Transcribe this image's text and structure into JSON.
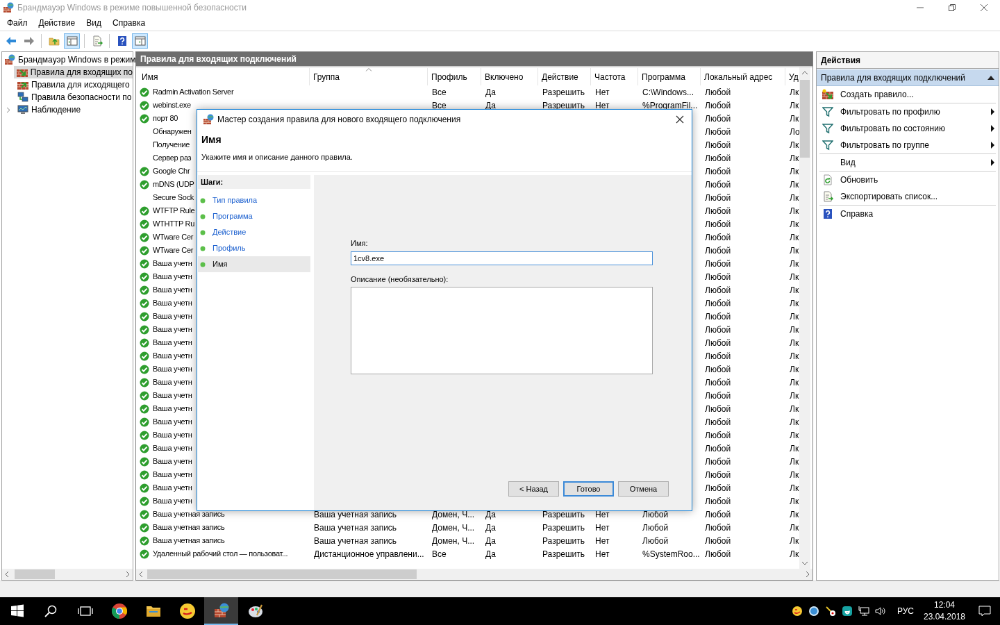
{
  "window": {
    "title": "Брандмауэр Windows в режиме повышенной безопасности"
  },
  "menu": [
    "Файл",
    "Действие",
    "Вид",
    "Справка"
  ],
  "toolbar": [
    {
      "kind": "back",
      "pressed": false
    },
    {
      "kind": "forward",
      "pressed": false
    },
    {
      "kind": "separator"
    },
    {
      "kind": "folder-up",
      "pressed": false
    },
    {
      "kind": "tree-pane",
      "pressed": true
    },
    {
      "kind": "separator"
    },
    {
      "kind": "export",
      "pressed": false
    },
    {
      "kind": "separator"
    },
    {
      "kind": "help",
      "pressed": false
    },
    {
      "kind": "action-pane",
      "pressed": true
    }
  ],
  "tree": {
    "label": "Брандмауэр Windows в режим",
    "kind": "root",
    "selected": false,
    "expandable": false,
    "children": [
      {
        "label": "Правила для входящих по",
        "kind": "inbound",
        "selected": true,
        "expandable": false
      },
      {
        "label": "Правила для исходящего",
        "kind": "outbound",
        "selected": false,
        "expandable": false
      },
      {
        "label": "Правила безопасности по",
        "kind": "security",
        "selected": false,
        "expandable": false
      },
      {
        "label": "Наблюдение",
        "kind": "monitoring",
        "selected": false,
        "expandable": true
      }
    ]
  },
  "panel": {
    "title": "Правила для входящих подключений",
    "columns": [
      {
        "label": "Имя",
        "sorted": false
      },
      {
        "label": "Группа",
        "sorted": true
      },
      {
        "label": "Профиль",
        "sorted": false
      },
      {
        "label": "Включено",
        "sorted": false
      },
      {
        "label": "Действие",
        "sorted": false
      },
      {
        "label": "Частота",
        "sorted": false
      },
      {
        "label": "Программа",
        "sorted": false
      },
      {
        "label": "Локальный адрес",
        "sorted": false
      },
      {
        "label": "Уд",
        "sorted": false
      }
    ],
    "rows": [
      {
        "enabled": true,
        "cells": [
          "Radmin Activation Server",
          null,
          "Все",
          "Да",
          "Разрешить",
          "Нет",
          "C:\\Windows...",
          "Любой",
          "Лк"
        ]
      },
      {
        "enabled": true,
        "cells": [
          "webinst.exe",
          null,
          "Все",
          "Да",
          "Разрешить",
          "Нет",
          "%ProgramFil...",
          "Любой",
          "Лк"
        ]
      },
      {
        "enabled": true,
        "cells": [
          "порт 80",
          null,
          null,
          null,
          null,
          null,
          null,
          "Любой",
          "Лк"
        ]
      },
      {
        "enabled": false,
        "cells": [
          "Обнаружен",
          null,
          null,
          null,
          null,
          null,
          null,
          "Любой",
          "Ло"
        ]
      },
      {
        "enabled": false,
        "cells": [
          "Получение",
          null,
          null,
          null,
          null,
          null,
          null,
          "Любой",
          "Лк"
        ]
      },
      {
        "enabled": false,
        "cells": [
          "Сервер раз",
          null,
          null,
          null,
          null,
          null,
          null,
          "Любой",
          "Лк"
        ]
      },
      {
        "enabled": true,
        "cells": [
          "Google Chr",
          null,
          null,
          null,
          null,
          null,
          null,
          "Любой",
          "Лк"
        ]
      },
      {
        "enabled": true,
        "cells": [
          "mDNS (UDP",
          null,
          null,
          null,
          null,
          null,
          null,
          "Любой",
          "Лк"
        ]
      },
      {
        "enabled": false,
        "cells": [
          "Secure Sock",
          null,
          null,
          null,
          null,
          null,
          null,
          "Любой",
          "Лк"
        ]
      },
      {
        "enabled": true,
        "cells": [
          "WTFTP Rule",
          null,
          null,
          null,
          null,
          null,
          null,
          "Любой",
          "Лк"
        ]
      },
      {
        "enabled": true,
        "cells": [
          "WTHTTP Ru",
          null,
          null,
          null,
          null,
          null,
          null,
          "Любой",
          "Лк"
        ]
      },
      {
        "enabled": true,
        "cells": [
          "WTware Cer",
          null,
          null,
          null,
          null,
          null,
          null,
          "Любой",
          "Лк"
        ]
      },
      {
        "enabled": true,
        "cells": [
          "WTware Cer",
          null,
          null,
          null,
          null,
          null,
          null,
          "Любой",
          "Лк"
        ]
      },
      {
        "enabled": true,
        "cells": [
          "Ваша учетн",
          null,
          null,
          null,
          null,
          null,
          null,
          "Любой",
          "Лк"
        ]
      },
      {
        "enabled": true,
        "cells": [
          "Ваша учетн",
          null,
          null,
          null,
          null,
          null,
          null,
          "Любой",
          "Лк"
        ]
      },
      {
        "enabled": true,
        "cells": [
          "Ваша учетн",
          null,
          null,
          null,
          null,
          null,
          null,
          "Любой",
          "Лк"
        ]
      },
      {
        "enabled": true,
        "cells": [
          "Ваша учетн",
          null,
          null,
          null,
          null,
          null,
          null,
          "Любой",
          "Лк"
        ]
      },
      {
        "enabled": true,
        "cells": [
          "Ваша учетн",
          null,
          null,
          null,
          null,
          null,
          null,
          "Любой",
          "Лк"
        ]
      },
      {
        "enabled": true,
        "cells": [
          "Ваша учетн",
          null,
          null,
          null,
          null,
          null,
          null,
          "Любой",
          "Лк"
        ]
      },
      {
        "enabled": true,
        "cells": [
          "Ваша учетн",
          null,
          null,
          null,
          null,
          null,
          null,
          "Любой",
          "Лк"
        ]
      },
      {
        "enabled": true,
        "cells": [
          "Ваша учетн",
          null,
          null,
          null,
          null,
          null,
          null,
          "Любой",
          "Лк"
        ]
      },
      {
        "enabled": true,
        "cells": [
          "Ваша учетн",
          null,
          null,
          null,
          null,
          null,
          null,
          "Любой",
          "Лк"
        ]
      },
      {
        "enabled": true,
        "cells": [
          "Ваша учетн",
          null,
          null,
          null,
          null,
          null,
          null,
          "Любой",
          "Лк"
        ]
      },
      {
        "enabled": true,
        "cells": [
          "Ваша учетн",
          null,
          null,
          null,
          null,
          null,
          null,
          "Любой",
          "Лк"
        ]
      },
      {
        "enabled": true,
        "cells": [
          "Ваша учетн",
          null,
          null,
          null,
          null,
          null,
          null,
          "Любой",
          "Лк"
        ]
      },
      {
        "enabled": true,
        "cells": [
          "Ваша учетн",
          null,
          null,
          null,
          null,
          null,
          null,
          "Любой",
          "Лк"
        ]
      },
      {
        "enabled": true,
        "cells": [
          "Ваша учетн",
          null,
          null,
          null,
          null,
          null,
          null,
          "Любой",
          "Лк"
        ]
      },
      {
        "enabled": true,
        "cells": [
          "Ваша учетн",
          null,
          null,
          null,
          null,
          null,
          null,
          "Любой",
          "Лк"
        ]
      },
      {
        "enabled": true,
        "cells": [
          "Ваша учетн",
          null,
          null,
          null,
          null,
          null,
          null,
          "Любой",
          "Лк"
        ]
      },
      {
        "enabled": true,
        "cells": [
          "Ваша учетн",
          null,
          null,
          null,
          null,
          null,
          null,
          "Любой",
          "Лк"
        ]
      },
      {
        "enabled": true,
        "cells": [
          "Ваша учетн",
          null,
          null,
          null,
          null,
          null,
          null,
          "Любой",
          "Лк"
        ]
      },
      {
        "enabled": true,
        "cells": [
          "Ваша учетн",
          null,
          null,
          null,
          null,
          null,
          null,
          "Любой",
          "Лк"
        ]
      },
      {
        "enabled": true,
        "cells": [
          "Ваша учетная запись",
          "Ваша учетная запись",
          "Домен, Ч...",
          "Да",
          "Разрешить",
          "Нет",
          "Любой",
          "Любой",
          "Лк"
        ]
      },
      {
        "enabled": true,
        "cells": [
          "Ваша учетная запись",
          "Ваша учетная запись",
          "Домен, Ч...",
          "Да",
          "Разрешить",
          "Нет",
          "Любой",
          "Любой",
          "Лк"
        ]
      },
      {
        "enabled": true,
        "cells": [
          "Ваша учетная запись",
          "Ваша учетная запись",
          "Домен, Ч...",
          "Да",
          "Разрешить",
          "Нет",
          "Любой",
          "Любой",
          "Лк"
        ]
      },
      {
        "enabled": true,
        "cells": [
          "Удаленный рабочий стол — пользоват...",
          "Дистанционное управлени...",
          "Все",
          "Да",
          "Разрешить",
          "Нет",
          "%SystemRoo...",
          "Любой",
          "Лк"
        ]
      }
    ]
  },
  "actions": {
    "title": "Действия",
    "section": {
      "label": "Правила для входящих подключений",
      "expanded": true
    },
    "items": [
      {
        "kind": "create",
        "label": "Создать правило...",
        "submenu": false,
        "separator_after": true
      },
      {
        "kind": "filter",
        "label": "Фильтровать по профилю",
        "submenu": true,
        "separator_after": false
      },
      {
        "kind": "filter",
        "label": "Фильтровать по состоянию",
        "submenu": true,
        "separator_after": false
      },
      {
        "kind": "filter",
        "label": "Фильтровать по группе",
        "submenu": true,
        "separator_after": true
      },
      {
        "kind": "none",
        "label": "Вид",
        "submenu": true,
        "separator_after": true
      },
      {
        "kind": "refresh",
        "label": "Обновить",
        "submenu": false,
        "separator_after": false
      },
      {
        "kind": "export",
        "label": "Экспортировать список...",
        "submenu": false,
        "separator_after": true
      },
      {
        "kind": "help",
        "label": "Справка",
        "submenu": false,
        "separator_after": false
      }
    ]
  },
  "dialog": {
    "title": "Мастер создания правила для нового входящего подключения",
    "heading": "Имя",
    "subtitle": "Укажите имя и описание данного правила.",
    "steps_title": "Шаги:",
    "steps": [
      {
        "label": "Тип правила",
        "selected": false
      },
      {
        "label": "Программа",
        "selected": false
      },
      {
        "label": "Действие",
        "selected": false
      },
      {
        "label": "Профиль",
        "selected": false
      },
      {
        "label": "Имя",
        "selected": true
      }
    ],
    "fields": [
      {
        "kind": "line",
        "label": "Имя:",
        "value": "1cv8.exe"
      },
      {
        "kind": "area",
        "label": "Описание (необязательно):"
      }
    ],
    "buttons": [
      {
        "label": "< Назад",
        "default": false
      },
      {
        "label": "Готово",
        "default": true
      },
      {
        "label": "Отмена",
        "default": false
      }
    ]
  },
  "taskbar": {
    "apps": [
      {
        "kind": "start",
        "active": false
      },
      {
        "kind": "search",
        "active": false
      },
      {
        "kind": "taskview",
        "active": false
      },
      {
        "kind": "chrome",
        "active": false
      },
      {
        "kind": "explorer",
        "active": false
      },
      {
        "kind": "onec",
        "active": false
      },
      {
        "kind": "firewall",
        "active": true
      },
      {
        "kind": "paint",
        "active": false
      }
    ],
    "tray": {
      "language": "РУС",
      "time": "12:04",
      "date": "23.04.2018"
    }
  }
}
